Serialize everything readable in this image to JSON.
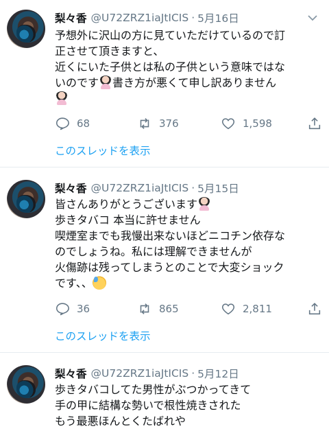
{
  "tweets": [
    {
      "name": "梨々香",
      "handle": "@U72ZRZ1iaJtICIS",
      "separator": "·",
      "date": "5月16日",
      "lines": [
        "予想外に沢山の方に見ていただけているので訂",
        "正させて頂きますと、",
        "近くにいた子供とは私の子供という意味ではな",
        "いのです",
        "書き方が悪くて申し訳ありません"
      ],
      "replies": "68",
      "retweets": "376",
      "likes": "1,598",
      "thread_label": "このスレッドを表示"
    },
    {
      "name": "梨々香",
      "handle": "@U72ZRZ1iaJtICIS",
      "separator": "·",
      "date": "5月15日",
      "lines": [
        "皆さんありがとうございます",
        "歩きタバコ 本当に許せません",
        "喫煙室までも我慢出来ないほどニコチン依存な",
        "のでしょうね。私には理解できませんが",
        "火傷跡は残ってしまうとのことで大変ショック",
        "です、、"
      ],
      "replies": "36",
      "retweets": "865",
      "likes": "2,811",
      "thread_label": "このスレッドを表示"
    },
    {
      "name": "梨々香",
      "handle": "@U72ZRZ1iaJtICIS",
      "separator": "·",
      "date": "5月12日",
      "lines": [
        "歩きタバコしてた男性がぶつかってきて",
        "手の甲に結構な勢いで根性焼きされた",
        "もう最悪ほんとくたばれや"
      ]
    }
  ],
  "icons": {
    "caret": "chevron-down-icon",
    "reply": "reply-icon",
    "retweet": "retweet-icon",
    "like": "heart-icon",
    "share": "share-icon"
  },
  "colors": {
    "text": "#14171a",
    "secondary": "#657786",
    "link": "#1da1f2",
    "divider": "#e6ecf0"
  }
}
